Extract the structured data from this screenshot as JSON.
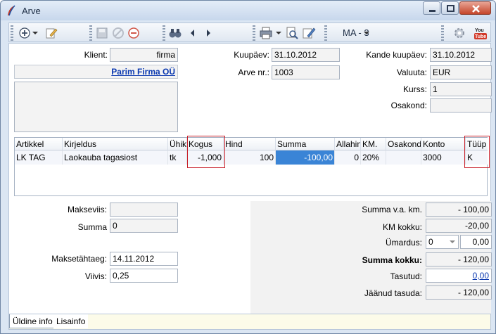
{
  "window": {
    "title": "Arve"
  },
  "toolbar": {
    "document_type": "MA - 3"
  },
  "header": {
    "klient_label": "Klient:",
    "klient_value": "firma",
    "company_name": "Parim Firma OÜ",
    "kuupaev_label": "Kuupäev:",
    "kuupaev_value": "31.10.2012",
    "arve_nr_label": "Arve nr.:",
    "arve_nr_value": "1003",
    "kande_kuupaev_label": "Kande kuupäev:",
    "kande_kuupaev_value": "31.10.2012",
    "valuuta_label": "Valuuta:",
    "valuuta_value": "EUR",
    "kurss_label": "Kurss:",
    "kurss_value": "1",
    "osakond_label": "Osakond:",
    "osakond_value": ""
  },
  "grid": {
    "columns": [
      "Artikkel",
      "Kirjeldus",
      "Ühik",
      "Kogus",
      "Hind",
      "Summa",
      "Allahind",
      "KM.",
      "Osakond",
      "Konto",
      "Tüüp"
    ],
    "row": {
      "artikkel": "LK TAG",
      "kirjeldus": "Laokauba tagasiost",
      "uhik": "tk",
      "kogus": "-1,000",
      "hind": "100",
      "summa": "-100,00",
      "allahind": "0",
      "km": "20%",
      "osakond": "",
      "konto": "3000",
      "tuup": "K"
    }
  },
  "payment": {
    "makseviis_label": "Makseviis:",
    "makseviis_value": "",
    "summa_label": "Summa",
    "summa_value": "0",
    "maksetahtaeg_label": "Maksetähtaeg:",
    "maksetahtaeg_value": "14.11.2012",
    "viivis_label": "Viivis:",
    "viivis_value": "0,25"
  },
  "totals": {
    "summa_vaa_km_label": "Summa v.a. km.",
    "summa_vaa_km_value": "- 100,00",
    "km_kokku_label": "KM kokku:",
    "km_kokku_value": "-20,00",
    "umardus_label": "Ümardus:",
    "umardus_select": "0",
    "umardus_value": "0,00",
    "summa_kokku_label": "Summa kokku:",
    "summa_kokku_value": "- 120,00",
    "tasutud_label": "Tasutud:",
    "tasutud_value": "0,00",
    "jaanud_tasuda_label": "Jäänud tasuda:",
    "jaanud_tasuda_value": "- 120,00"
  },
  "tabs": {
    "tab1": "Üldine info",
    "tab2": "Lisainfo"
  },
  "colors": {
    "selected_cell": "#3a84d6",
    "highlight_box": "#c8202a",
    "link": "#0b39b0"
  }
}
